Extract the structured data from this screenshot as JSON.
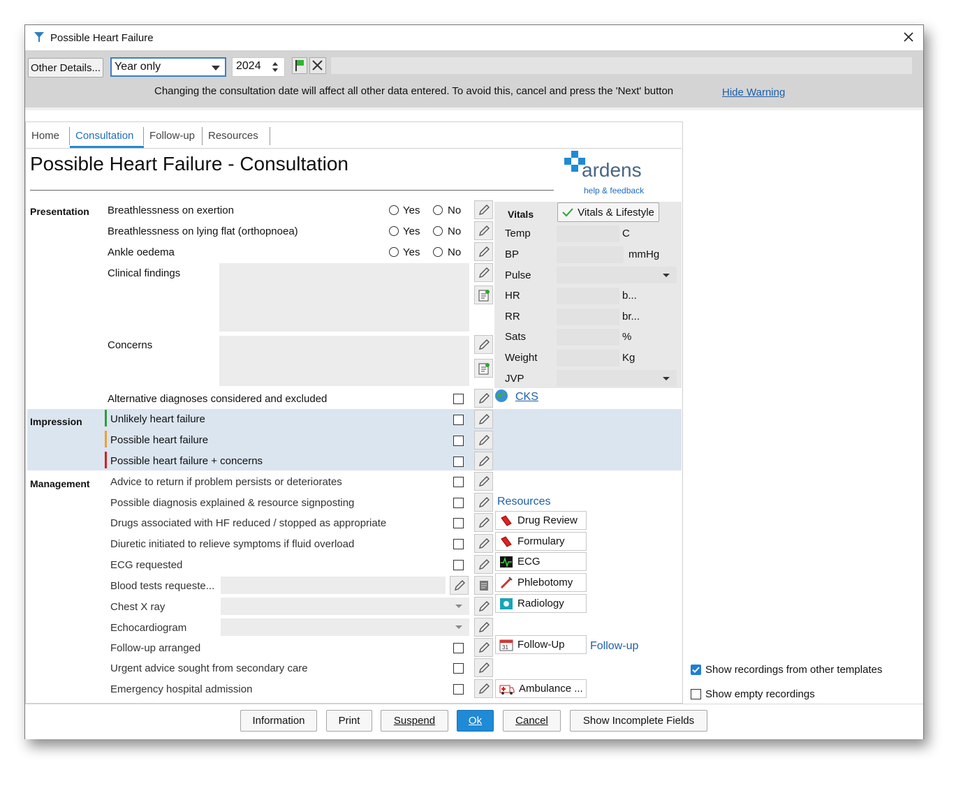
{
  "window": {
    "title": "Possible Heart Failure"
  },
  "toolbar": {
    "other_details_label": "Other Details...",
    "date_precision": "Year only",
    "year_value": "2024",
    "warning_text": "Changing the consultation date will affect all other data entered. To avoid this, cancel and press the 'Next' button",
    "hide_warning_label": "Hide Warning"
  },
  "tabs": [
    {
      "label": "Home"
    },
    {
      "label": "Consultation",
      "active": true
    },
    {
      "label": "Follow-up"
    },
    {
      "label": "Resources"
    }
  ],
  "page": {
    "title": "Possible Heart Failure - Consultation"
  },
  "logo": {
    "name": "ardens",
    "help_label": "help & feedback"
  },
  "presentation": {
    "section_label": "Presentation",
    "yes_label": "Yes",
    "no_label": "No",
    "items": [
      {
        "label": "Breathlessness on exertion"
      },
      {
        "label": "Breathlessness on lying flat (orthopnoea)"
      },
      {
        "label": "Ankle oedema"
      }
    ],
    "clinical_findings_label": "Clinical findings",
    "concerns_label": "Concerns",
    "alt_diagnoses_label": "Alternative diagnoses considered and excluded"
  },
  "impression": {
    "section_label": "Impression",
    "items": [
      {
        "label": "Unlikely heart failure",
        "color": "#2e9e3a"
      },
      {
        "label": "Possible heart failure",
        "color": "#f0a030"
      },
      {
        "label": "Possible heart failure + concerns",
        "color": "#d32020"
      }
    ]
  },
  "management": {
    "section_label": "Management",
    "items": [
      {
        "label": "Advice to return if problem persists or deteriorates"
      },
      {
        "label": "Possible diagnosis explained & resource signposting"
      },
      {
        "label": "Drugs associated with HF reduced / stopped as appropriate"
      },
      {
        "label": "Diuretic initiated to relieve symptoms if fluid overload"
      },
      {
        "label": "ECG requested"
      },
      {
        "label": "Blood tests requeste..."
      },
      {
        "label": "Chest X ray"
      },
      {
        "label": "Echocardiogram"
      },
      {
        "label": "Follow-up arranged"
      },
      {
        "label": "Urgent advice sought from secondary care"
      },
      {
        "label": "Emergency hospital admission"
      }
    ]
  },
  "vitals": {
    "section_label": "Vitals",
    "lifestyle_button": "Vitals & Lifestyle",
    "rows": [
      {
        "label": "Temp",
        "unit": "C"
      },
      {
        "label": "BP",
        "unit": "mmHg"
      },
      {
        "label": "Pulse",
        "unit": ""
      },
      {
        "label": "HR",
        "unit": "b..."
      },
      {
        "label": "RR",
        "unit": "br..."
      },
      {
        "label": "Sats",
        "unit": "%"
      },
      {
        "label": "Weight",
        "unit": "Kg"
      },
      {
        "label": "JVP",
        "unit": ""
      }
    ],
    "cks_label": "CKS"
  },
  "resources": {
    "heading": "Resources",
    "buttons": [
      {
        "label": "Drug Review"
      },
      {
        "label": "Formulary"
      },
      {
        "label": "ECG"
      },
      {
        "label": "Phlebotomy"
      },
      {
        "label": "Radiology"
      }
    ],
    "followup_button": "Follow-Up",
    "followup_link": "Follow-up",
    "ambulance_button": "Ambulance ..."
  },
  "options": {
    "show_other_templates": {
      "label": "Show recordings from other templates",
      "checked": true
    },
    "show_empty": {
      "label": "Show empty recordings",
      "checked": false
    }
  },
  "footer": {
    "information": "Information",
    "print": "Print",
    "suspend": "Suspend",
    "ok": "Ok",
    "cancel": "Cancel",
    "show_incomplete": "Show Incomplete Fields"
  },
  "colors": {
    "accent": "#1f8ad6",
    "link": "#1f5fa8",
    "impression_bg": "#dbe5f0",
    "toolbar_bg": "#d4d4d4"
  }
}
